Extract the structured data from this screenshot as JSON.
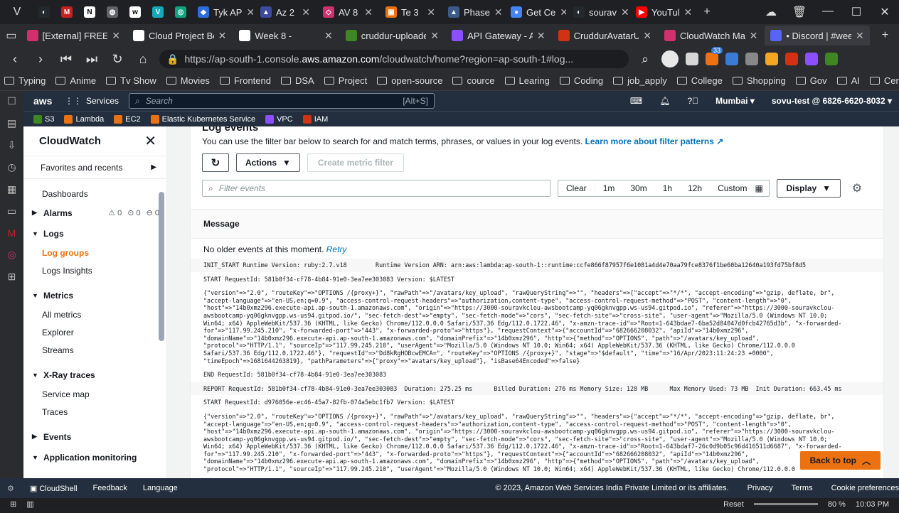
{
  "browser": {
    "tabs_top": [
      {
        "label": "",
        "color": "#24292e",
        "glyph": "◐"
      },
      {
        "label": "",
        "color": "#c5221f",
        "glyph": "M"
      },
      {
        "label": "",
        "color": "#ffffff",
        "glyph": "N"
      },
      {
        "label": "",
        "color": "#5f6368",
        "glyph": "◍"
      },
      {
        "label": "",
        "color": "#ffffff",
        "glyph": "w"
      },
      {
        "label": "",
        "color": "#14a8b8",
        "glyph": "V"
      },
      {
        "label": "",
        "color": "#10a37f",
        "glyph": "◎"
      },
      {
        "label": "Tyk AP",
        "color": "#2d6cdf",
        "glyph": "◆"
      },
      {
        "label": "Az 2",
        "color": "#3b4ba0",
        "glyph": "▲"
      },
      {
        "label": "AV 8",
        "color": "#d1306f",
        "glyph": "◇"
      },
      {
        "label": "Te 3",
        "color": "#ec7211",
        "glyph": "▣"
      },
      {
        "label": "Phase",
        "color": "#3b5b8a",
        "glyph": "▲"
      },
      {
        "label": "Get Ce",
        "color": "#4285f4",
        "glyph": "●"
      },
      {
        "label": "sourav",
        "color": "#24292e",
        "glyph": "◐"
      },
      {
        "label": "YouTul",
        "color": "#ff0000",
        "glyph": "▶"
      }
    ],
    "tabs_second": [
      {
        "label": "[External] FREE AV",
        "color": "#d1306f",
        "active": false
      },
      {
        "label": "Cloud Project Boo",
        "color": "#ffffff",
        "active": false
      },
      {
        "label": "Week 8 -",
        "color": "#ffffff",
        "active": false
      },
      {
        "label": "cruddur-uploade",
        "color": "#3f8624",
        "active": false
      },
      {
        "label": "API Gateway - AP",
        "color": "#8c4fff",
        "active": false
      },
      {
        "label": "CruddurAvatarUp",
        "color": "#d13212",
        "active": false
      },
      {
        "label": "CloudWatch Man",
        "color": "#d1306f",
        "active": false
      },
      {
        "label": "• Discord | #week",
        "color": "#5865f2",
        "active": true
      }
    ],
    "url_host": "https://ap-south-1.console.",
    "url_domain": "aws.amazon.com",
    "url_path": "/cloudwatch/home?region=ap-south-1#log...",
    "extension_badge": "33",
    "bookmarks": [
      "Typing",
      "Anime",
      "Tv Show",
      "Movies",
      "Frontend",
      "DSA",
      "Project",
      "open-source",
      "cource",
      "Learing",
      "Coding",
      "job_apply",
      "College",
      "Shopping",
      "Gov",
      "AI",
      "Certifications"
    ]
  },
  "aws": {
    "logo": "aws",
    "services_label": "Services",
    "search_placeholder": "Search",
    "search_shortcut": "[Alt+S]",
    "region": "Mumbai ▾",
    "account": "sovu-test @ 6826-6620-8032 ▾",
    "favorites": [
      {
        "label": "S3",
        "color": "#3f8624"
      },
      {
        "label": "Lambda",
        "color": "#ec7211"
      },
      {
        "label": "EC2",
        "color": "#ec7211"
      },
      {
        "label": "Elastic Kubernetes Service",
        "color": "#ec7211"
      },
      {
        "label": "VPC",
        "color": "#8c4fff"
      },
      {
        "label": "IAM",
        "color": "#d13212"
      }
    ]
  },
  "sidenav": {
    "title": "CloudWatch",
    "favorites": "Favorites and recents",
    "dashboards": "Dashboards",
    "alarms": "Alarms",
    "alarm_counts": [
      "0",
      "0",
      "0"
    ],
    "logs": "Logs",
    "log_groups": "Log groups",
    "logs_insights": "Logs Insights",
    "metrics": "Metrics",
    "all_metrics": "All metrics",
    "explorer": "Explorer",
    "streams": "Streams",
    "xray": "X-Ray traces",
    "service_map": "Service map",
    "traces": "Traces",
    "events": "Events",
    "app_monitoring": "Application monitoring"
  },
  "logpanel": {
    "title": "Log events",
    "description": "You can use the filter bar below to search for and match terms, phrases, or values in your log events.",
    "learn_more": "Learn more about filter patterns",
    "actions": "Actions",
    "create_metric_filter": "Create metric filter",
    "filter_placeholder": "Filter events",
    "time_ranges": [
      "Clear",
      "1m",
      "30m",
      "1h",
      "12h",
      "Custom"
    ],
    "display": "Display",
    "message_header": "Message",
    "no_older": "No older events at this moment.",
    "retry": "Retry",
    "back_to_top": "Back to top",
    "rows": [
      {
        "text": "INIT_START Runtime Version: ruby:2.7.v18        Runtime Version ARN: arn:aws:lambda:ap-south-1::runtime:ccfe866f87957f6e1081a4d4e70aa79fce8376f1be60ba12640a193fd75bf8d5",
        "alt": true
      },
      {
        "text": "START RequestId: 581b0f34-cf78-4b84-91e0-3ea7ee303083 Version: $LATEST",
        "alt": false
      },
      {
        "text": "{\"version\"=>\"2.0\", \"routeKey\"=>\"OPTIONS /{proxy+}\", \"rawPath\"=>\"/avatars/key_upload\", \"rawQueryString\"=>\"\", \"headers\"=>{\"accept\"=>\"*/*\", \"accept-encoding\"=>\"gzip, deflate, br\",\n\"accept-language\"=>\"en-US,en;q=0.9\", \"access-control-request-headers\"=>\"authorization,content-type\", \"access-control-request-method\"=>\"POST\", \"content-length\"=>\"0\",\n\"host\"=>\"14b0xmz296.execute-api.ap-south-1.amazonaws.com\", \"origin\"=>\"https://3000-souravkclou-awsbootcamp-yq06gknvgpp.ws-us94.gitpod.io\", \"referer\"=>\"https://3000-souravkclou-\nawsbootcamp-yq06gknvgpp.ws-us94.gitpod.io/\", \"sec-fetch-dest\"=>\"empty\", \"sec-fetch-mode\"=>\"cors\", \"sec-fetch-site\"=>\"cross-site\", \"user-agent\"=>\"Mozilla/5.0 (Windows NT 10.0;\nWin64; x64) AppleWebKit/537.36 (KHTML, like Gecko) Chrome/112.0.0.0 Safari/537.36 Edg/112.0.1722.46\", \"x-amzn-trace-id\"=>\"Root=1-643bdae7-6ba52d84047d0fcb42765d3b\", \"x-forwarded-\nfor\"=>\"117.99.245.210\", \"x-forwarded-port\"=>\"443\", \"x-forwarded-proto\"=>\"https\"}, \"requestContext\"=>{\"accountId\"=>\"682666208032\", \"apiId\"=>\"14b0xmz296\",\n\"domainName\"=>\"14b0xmz296.execute-api.ap-south-1.amazonaws.com\", \"domainPrefix\"=>\"14b0xmz296\", \"http\"=>{\"method\"=>\"OPTIONS\", \"path\"=>\"/avatars/key_upload\",\n\"protocol\"=>\"HTTP/1.1\", \"sourceIp\"=>\"117.99.245.210\", \"userAgent\"=>\"Mozilla/5.0 (Windows NT 10.0; Win64; x64) AppleWebKit/537.36 (KHTML, like Gecko) Chrome/112.0.0.0\nSafari/537.36 Edg/112.0.1722.46\"}, \"requestId\"=>\"Dd8kRgHOBcwEMCA=\", \"routeKey\"=>\"OPTIONS /{proxy+}\", \"stage\"=>\"$default\", \"time\"=>\"16/Apr/2023:11:24:23 +0000\",\n\"timeEpoch\"=>1681644263819}, \"pathParameters\"=>{\"proxy\"=>\"avatars/key_upload\"}, \"isBase64Encoded\"=>false}",
        "alt": false
      },
      {
        "text": "END RequestId: 581b0f34-cf78-4b84-91e0-3ea7ee303083",
        "alt": false
      },
      {
        "text": "REPORT RequestId: 581b0f34-cf78-4b84-91e0-3ea7ee303083  Duration: 275.25 ms      Billed Duration: 276 ms Memory Size: 128 MB      Max Memory Used: 73 MB  Init Duration: 663.45 ms",
        "alt": true
      },
      {
        "text": "START RequestId: d976056e-ec46-45a7-82fb-074a5ebc1fb7 Version: $LATEST",
        "alt": false
      },
      {
        "text": "{\"version\"=>\"2.0\", \"routeKey\"=>\"OPTIONS /{proxy+}\", \"rawPath\"=>\"/avatars/key_upload\", \"rawQueryString\"=>\"\", \"headers\"=>{\"accept\"=>\"*/*\", \"accept-encoding\"=>\"gzip, deflate, br\",\n\"accept-language\"=>\"en-US,en;q=0.9\", \"access-control-request-headers\"=>\"authorization,content-type\", \"access-control-request-method\"=>\"POST\", \"content-length\"=>\"0\",\n\"host\"=>\"14b0xmz296.execute-api.ap-south-1.amazonaws.com\", \"origin\"=>\"https://3000-souravkclou-awsbootcamp-yq06gknvgpp.ws-us94.gitpod.io\", \"referer\"=>\"https://3000-souravkclou-\nawsbootcamp-yq06gknvgpp.ws-us94.gitpod.io/\", \"sec-fetch-dest\"=>\"empty\", \"sec-fetch-mode\"=>\"cors\", \"sec-fetch-site\"=>\"cross-site\", \"user-agent\"=>\"Mozilla/5.0 (Windows NT 10.0;\nWin64; x64) AppleWebKit/537.36 (KHTML, like Gecko) Chrome/112.0.0.0 Safari/537.36 Edg/112.0.1722.46\", \"x-amzn-trace-id\"=>\"Root=1-643bdaf7-26c0d9b05c96d416511d6687\", \"x-forwarded-\nfor\"=>\"117.99.245.210\", \"x-forwarded-port\"=>\"443\", \"x-forwarded-proto\"=>\"https\"}, \"requestContext\"=>{\"accountId\"=>\"682666208032\", \"apiId\"=>\"14b0xmz296\",\n\"domainName\"=>\"14b0xmz296.execute-api.ap-south-1.amazonaws.com\", \"domainPrefix\"=>\"14b0xmz296\", \"http\"=>{\"method\"=>\"OPTIONS\", \"path\"=>\"/avatars/key_upload\",\n\"protocol\"=>\"HTTP/1.1\", \"sourceIp\"=>\"117.99.245.210\", \"userAgent\"=>\"Mozilla/5.0 (Windows NT 10.0; Win64; x64) AppleWebKit/537.36 (KHTML, like Gecko) Chrome/112.0.0.0",
        "alt": false
      }
    ]
  },
  "footer": {
    "cloudshell": "CloudShell",
    "feedback": "Feedback",
    "language": "Language",
    "copyright": "© 2023, Amazon Web Services India Private Limited or its affiliates.",
    "privacy": "Privacy",
    "terms": "Terms",
    "cookies": "Cookie preferences"
  },
  "taskbar": {
    "reset": "Reset",
    "zoom": "80 %",
    "time": "10:03 PM"
  }
}
